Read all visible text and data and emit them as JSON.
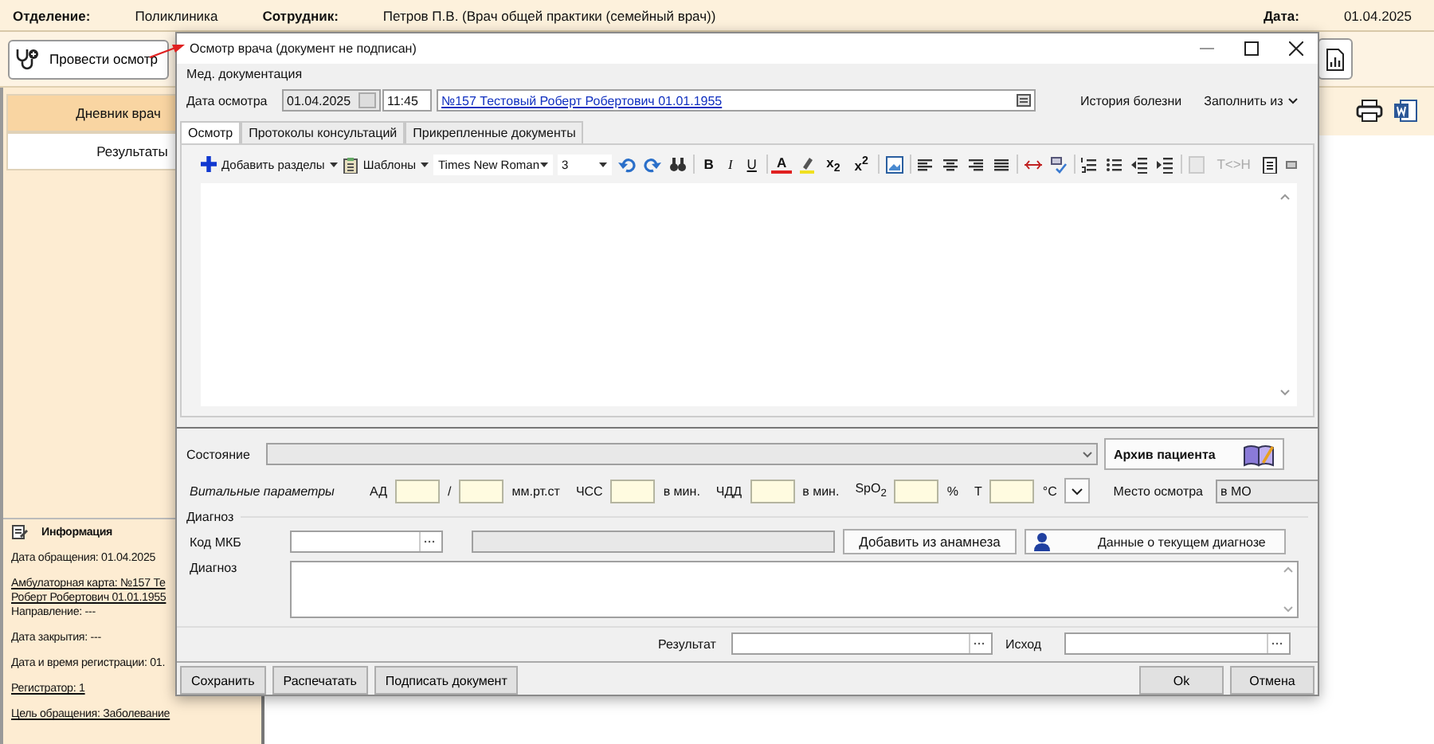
{
  "header": {
    "department": {
      "label": "Отделение:",
      "value": "Поликлиника"
    },
    "employee": {
      "label": "Сотрудник:",
      "value": "Петров П.В. (Врач общей практики (семейный врач))"
    },
    "date": {
      "label": "Дата:",
      "value": "01.04.2025"
    }
  },
  "toolbar": {
    "examine_button": "Провести осмотр"
  },
  "side_tabs": [
    {
      "label": "Дневник врач",
      "selected": true
    },
    {
      "label": "Результаты",
      "selected": false
    }
  ],
  "info": {
    "title": "Информация",
    "groups": [
      [
        {
          "text": "Дата обращения: 01.04.2025",
          "kind": "plain"
        }
      ],
      [
        {
          "text": "Амбулаторная карта: №157 Те",
          "kind": "link"
        },
        {
          "text": "Роберт Робертович 01.01.1955",
          "kind": "link"
        },
        {
          "text": "Направление: ---",
          "kind": "plain"
        }
      ],
      [
        {
          "text": "Дата закрытия: ---",
          "kind": "plain"
        }
      ],
      [
        {
          "text": "Дата и время регистрации: 01.",
          "kind": "plain"
        }
      ],
      [
        {
          "text": "Регистратор: 1",
          "kind": "link"
        }
      ],
      [
        {
          "text": "Цель обращения: Заболевание",
          "kind": "link"
        }
      ]
    ]
  },
  "dialog": {
    "title": "Осмотр врача (документ не подписан)",
    "menu": "Мед. документация",
    "date_label": "Дата осмотра",
    "date": "01.04.2025",
    "time": "11:45",
    "patient_link": "№157 Тестовый Роберт Робертович 01.01.1955",
    "history": "История болезни",
    "fill_from": "Заполнить из",
    "tabs": [
      {
        "label": "Осмотр",
        "selected": true
      },
      {
        "label": "Протоколы консультаций",
        "selected": false
      },
      {
        "label": "Прикрепленные документы",
        "selected": false
      }
    ],
    "editor": {
      "add_sections": "Добавить разделы",
      "templates": "Шаблоны",
      "font": "Times New Roman",
      "size": "3",
      "bold": "B",
      "italic": "I",
      "underline": "U",
      "font_color": "A",
      "subscript": "x$_{2}$",
      "superscript": "x$^{2}$",
      "tag_toggle": {
        "text": "T<>H",
        "disabled": true
      }
    },
    "state_label": "Состояние",
    "archive_button": "Архив пациента",
    "vitals": {
      "label": "Витальные параметры",
      "items": [
        {
          "kind": "text",
          "text": "АД"
        },
        {
          "kind": "field"
        },
        {
          "kind": "text",
          "text": "/"
        },
        {
          "kind": "field"
        },
        {
          "kind": "text",
          "text": "мм.рт.ст"
        },
        {
          "kind": "text",
          "text": "ЧСС"
        },
        {
          "kind": "field"
        },
        {
          "kind": "text",
          "text": "в мин."
        },
        {
          "kind": "text",
          "text": "ЧДД"
        },
        {
          "kind": "field"
        },
        {
          "kind": "text",
          "text": "в мин."
        },
        {
          "kind": "text",
          "text": "SpO$_{2}$"
        },
        {
          "kind": "field"
        },
        {
          "kind": "text",
          "text": "%"
        },
        {
          "kind": "text",
          "text": "Т"
        },
        {
          "kind": "field"
        },
        {
          "kind": "text",
          "text": "°C"
        }
      ]
    },
    "place": {
      "label": "Место осмотра",
      "value": "в МО"
    },
    "diagnosis_group": "Диагноз",
    "mkb_label": "Код МКБ",
    "add_from_history": "Добавить из анамнеза",
    "current_diagnosis": "Данные о текущем диагнозе",
    "diagnosis_label": "Диагноз",
    "result_label": "Результат",
    "outcome_label": "Исход",
    "left_buttons": [
      "Сохранить",
      "Распечатать",
      "Подписать документ"
    ],
    "right_buttons": [
      "Ok",
      "Отмена"
    ]
  }
}
